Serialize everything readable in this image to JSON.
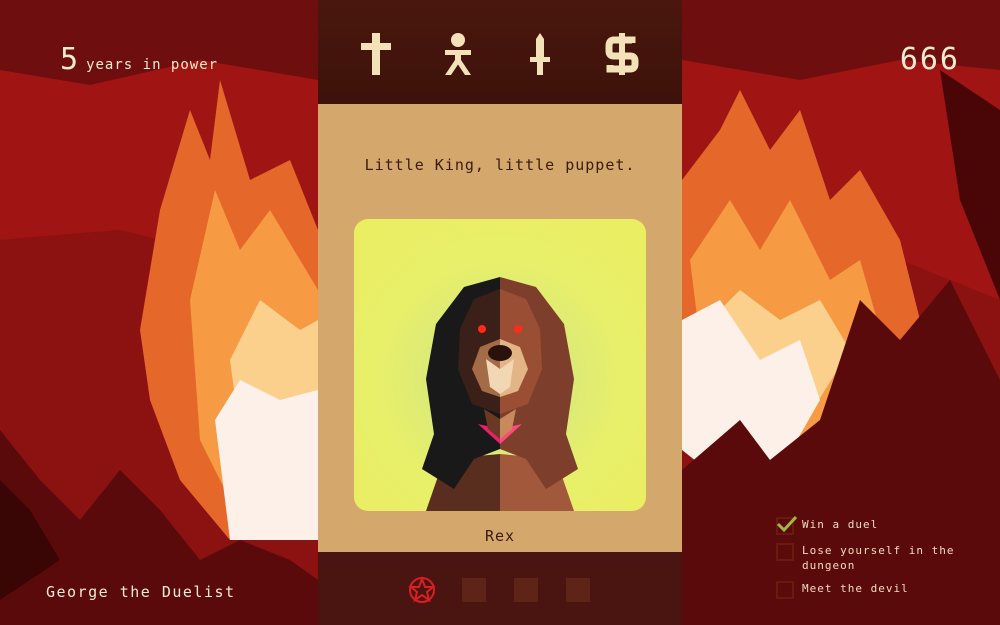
{
  "hud": {
    "years_number": "5",
    "years_label": "years in power",
    "year_count": "666"
  },
  "king": {
    "name": "George the Duelist"
  },
  "stats": [
    {
      "name": "church",
      "icon": "cross-icon"
    },
    {
      "name": "people",
      "icon": "person-icon"
    },
    {
      "name": "army",
      "icon": "sword-icon"
    },
    {
      "name": "money",
      "icon": "dollar-icon"
    }
  ],
  "card": {
    "question": "Little King, little puppet.",
    "character_name": "Rex",
    "portrait": "dog-portrait"
  },
  "bottom_slots": [
    {
      "icon": "pentagram-icon",
      "active": true
    },
    {
      "icon": "empty-slot",
      "active": false
    },
    {
      "icon": "empty-slot",
      "active": false
    },
    {
      "icon": "empty-slot",
      "active": false
    }
  ],
  "objectives": [
    {
      "label": "Win a duel",
      "done": true
    },
    {
      "label": "Lose yourself in the dungeon",
      "done": false
    },
    {
      "label": "Meet the devil",
      "done": false
    }
  ],
  "colors": {
    "stat_icon": "#f3e1b7",
    "card_bg": "#d4a86d",
    "pentagram": "#d81f24",
    "check": "#a3b83a"
  }
}
